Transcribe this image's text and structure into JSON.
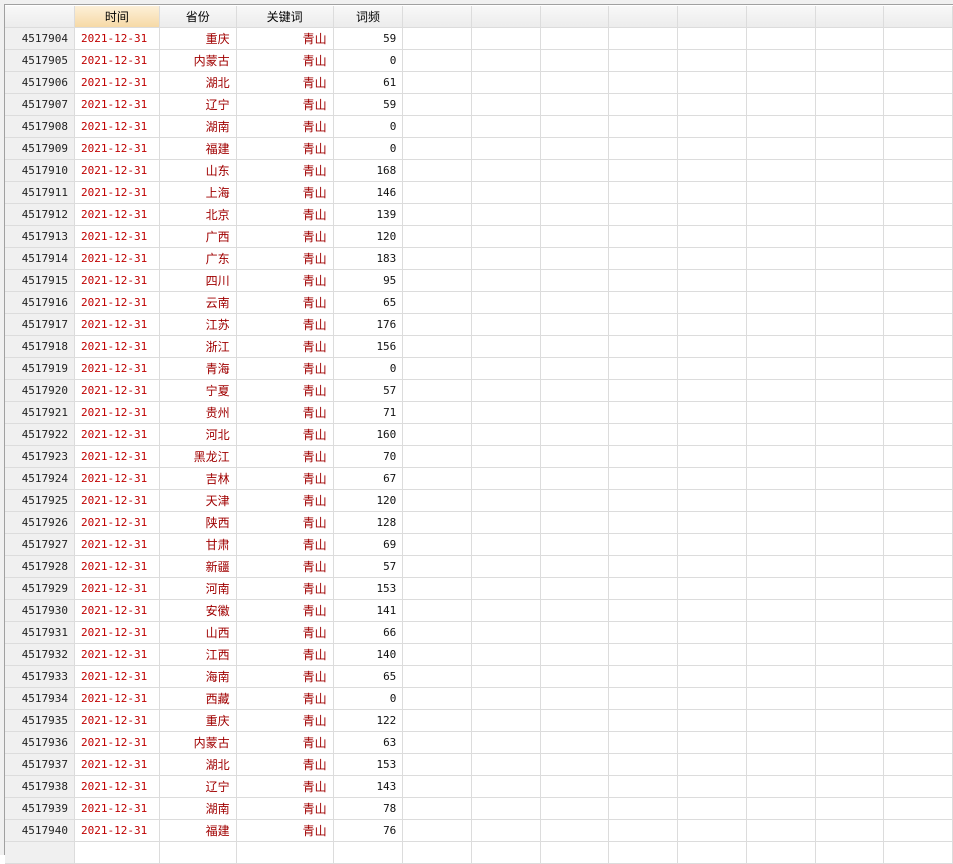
{
  "columns": [
    "",
    "时间",
    "省份",
    "关键词",
    "词频",
    "",
    "",
    "",
    "",
    "",
    "",
    "",
    ""
  ],
  "rows": [
    [
      "4517904",
      "2021-12-31",
      "重庆",
      "青山",
      "59"
    ],
    [
      "4517905",
      "2021-12-31",
      "内蒙古",
      "青山",
      "0"
    ],
    [
      "4517906",
      "2021-12-31",
      "湖北",
      "青山",
      "61"
    ],
    [
      "4517907",
      "2021-12-31",
      "辽宁",
      "青山",
      "59"
    ],
    [
      "4517908",
      "2021-12-31",
      "湖南",
      "青山",
      "0"
    ],
    [
      "4517909",
      "2021-12-31",
      "福建",
      "青山",
      "0"
    ],
    [
      "4517910",
      "2021-12-31",
      "山东",
      "青山",
      "168"
    ],
    [
      "4517911",
      "2021-12-31",
      "上海",
      "青山",
      "146"
    ],
    [
      "4517912",
      "2021-12-31",
      "北京",
      "青山",
      "139"
    ],
    [
      "4517913",
      "2021-12-31",
      "广西",
      "青山",
      "120"
    ],
    [
      "4517914",
      "2021-12-31",
      "广东",
      "青山",
      "183"
    ],
    [
      "4517915",
      "2021-12-31",
      "四川",
      "青山",
      "95"
    ],
    [
      "4517916",
      "2021-12-31",
      "云南",
      "青山",
      "65"
    ],
    [
      "4517917",
      "2021-12-31",
      "江苏",
      "青山",
      "176"
    ],
    [
      "4517918",
      "2021-12-31",
      "浙江",
      "青山",
      "156"
    ],
    [
      "4517919",
      "2021-12-31",
      "青海",
      "青山",
      "0"
    ],
    [
      "4517920",
      "2021-12-31",
      "宁夏",
      "青山",
      "57"
    ],
    [
      "4517921",
      "2021-12-31",
      "贵州",
      "青山",
      "71"
    ],
    [
      "4517922",
      "2021-12-31",
      "河北",
      "青山",
      "160"
    ],
    [
      "4517923",
      "2021-12-31",
      "黑龙江",
      "青山",
      "70"
    ],
    [
      "4517924",
      "2021-12-31",
      "吉林",
      "青山",
      "67"
    ],
    [
      "4517925",
      "2021-12-31",
      "天津",
      "青山",
      "120"
    ],
    [
      "4517926",
      "2021-12-31",
      "陕西",
      "青山",
      "128"
    ],
    [
      "4517927",
      "2021-12-31",
      "甘肃",
      "青山",
      "69"
    ],
    [
      "4517928",
      "2021-12-31",
      "新疆",
      "青山",
      "57"
    ],
    [
      "4517929",
      "2021-12-31",
      "河南",
      "青山",
      "153"
    ],
    [
      "4517930",
      "2021-12-31",
      "安徽",
      "青山",
      "141"
    ],
    [
      "4517931",
      "2021-12-31",
      "山西",
      "青山",
      "66"
    ],
    [
      "4517932",
      "2021-12-31",
      "江西",
      "青山",
      "140"
    ],
    [
      "4517933",
      "2021-12-31",
      "海南",
      "青山",
      "65"
    ],
    [
      "4517934",
      "2021-12-31",
      "西藏",
      "青山",
      "0"
    ],
    [
      "4517935",
      "2021-12-31",
      "重庆",
      "青山",
      "122"
    ],
    [
      "4517936",
      "2021-12-31",
      "内蒙古",
      "青山",
      "63"
    ],
    [
      "4517937",
      "2021-12-31",
      "湖北",
      "青山",
      "153"
    ],
    [
      "4517938",
      "2021-12-31",
      "辽宁",
      "青山",
      "143"
    ],
    [
      "4517939",
      "2021-12-31",
      "湖南",
      "青山",
      "78"
    ],
    [
      "4517940",
      "2021-12-31",
      "福建",
      "青山",
      "76"
    ]
  ]
}
